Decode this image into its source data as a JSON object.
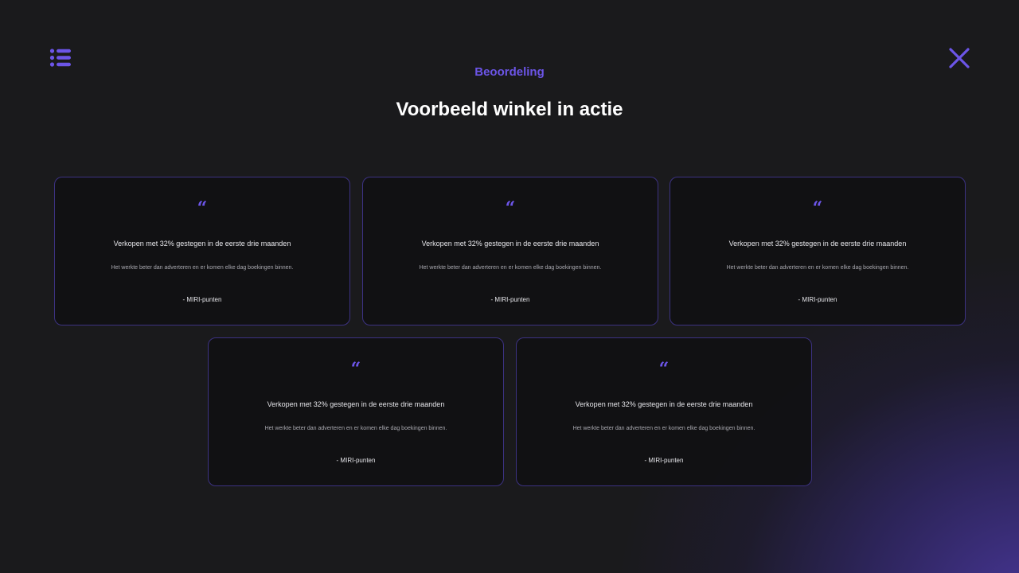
{
  "header": {
    "eyebrow": "Beoordeling",
    "title": "Voorbeeld winkel in actie"
  },
  "icons": {
    "menu": "list-icon",
    "close": "close-icon"
  },
  "colors": {
    "accent": "#6c55e8",
    "background": "#1a1a1c",
    "card_border": "#3c3282"
  },
  "testimonials": [
    {
      "quote_mark": "“",
      "headline": "Verkopen met 32% gestegen in de eerste drie maanden",
      "body": "Het werkte beter dan adverteren en er komen elke dag boekingen binnen.",
      "author": "- MIRI-punten"
    },
    {
      "quote_mark": "“",
      "headline": "Verkopen met 32% gestegen in de eerste drie maanden",
      "body": "Het werkte beter dan adverteren en er komen elke dag boekingen binnen.",
      "author": "- MIRI-punten"
    },
    {
      "quote_mark": "“",
      "headline": "Verkopen met 32% gestegen in de eerste drie maanden",
      "body": "Het werkte beter dan adverteren en er komen elke dag boekingen binnen.",
      "author": "- MIRI-punten"
    },
    {
      "quote_mark": "“",
      "headline": "Verkopen met 32% gestegen in de eerste drie maanden",
      "body": "Het werkte beter dan adverteren en er komen elke dag boekingen binnen.",
      "author": "- MIRI-punten"
    },
    {
      "quote_mark": "“",
      "headline": "Verkopen met 32% gestegen in de eerste drie maanden",
      "body": "Het werkte beter dan adverteren en er komen elke dag boekingen binnen.",
      "author": "- MIRI-punten"
    }
  ]
}
